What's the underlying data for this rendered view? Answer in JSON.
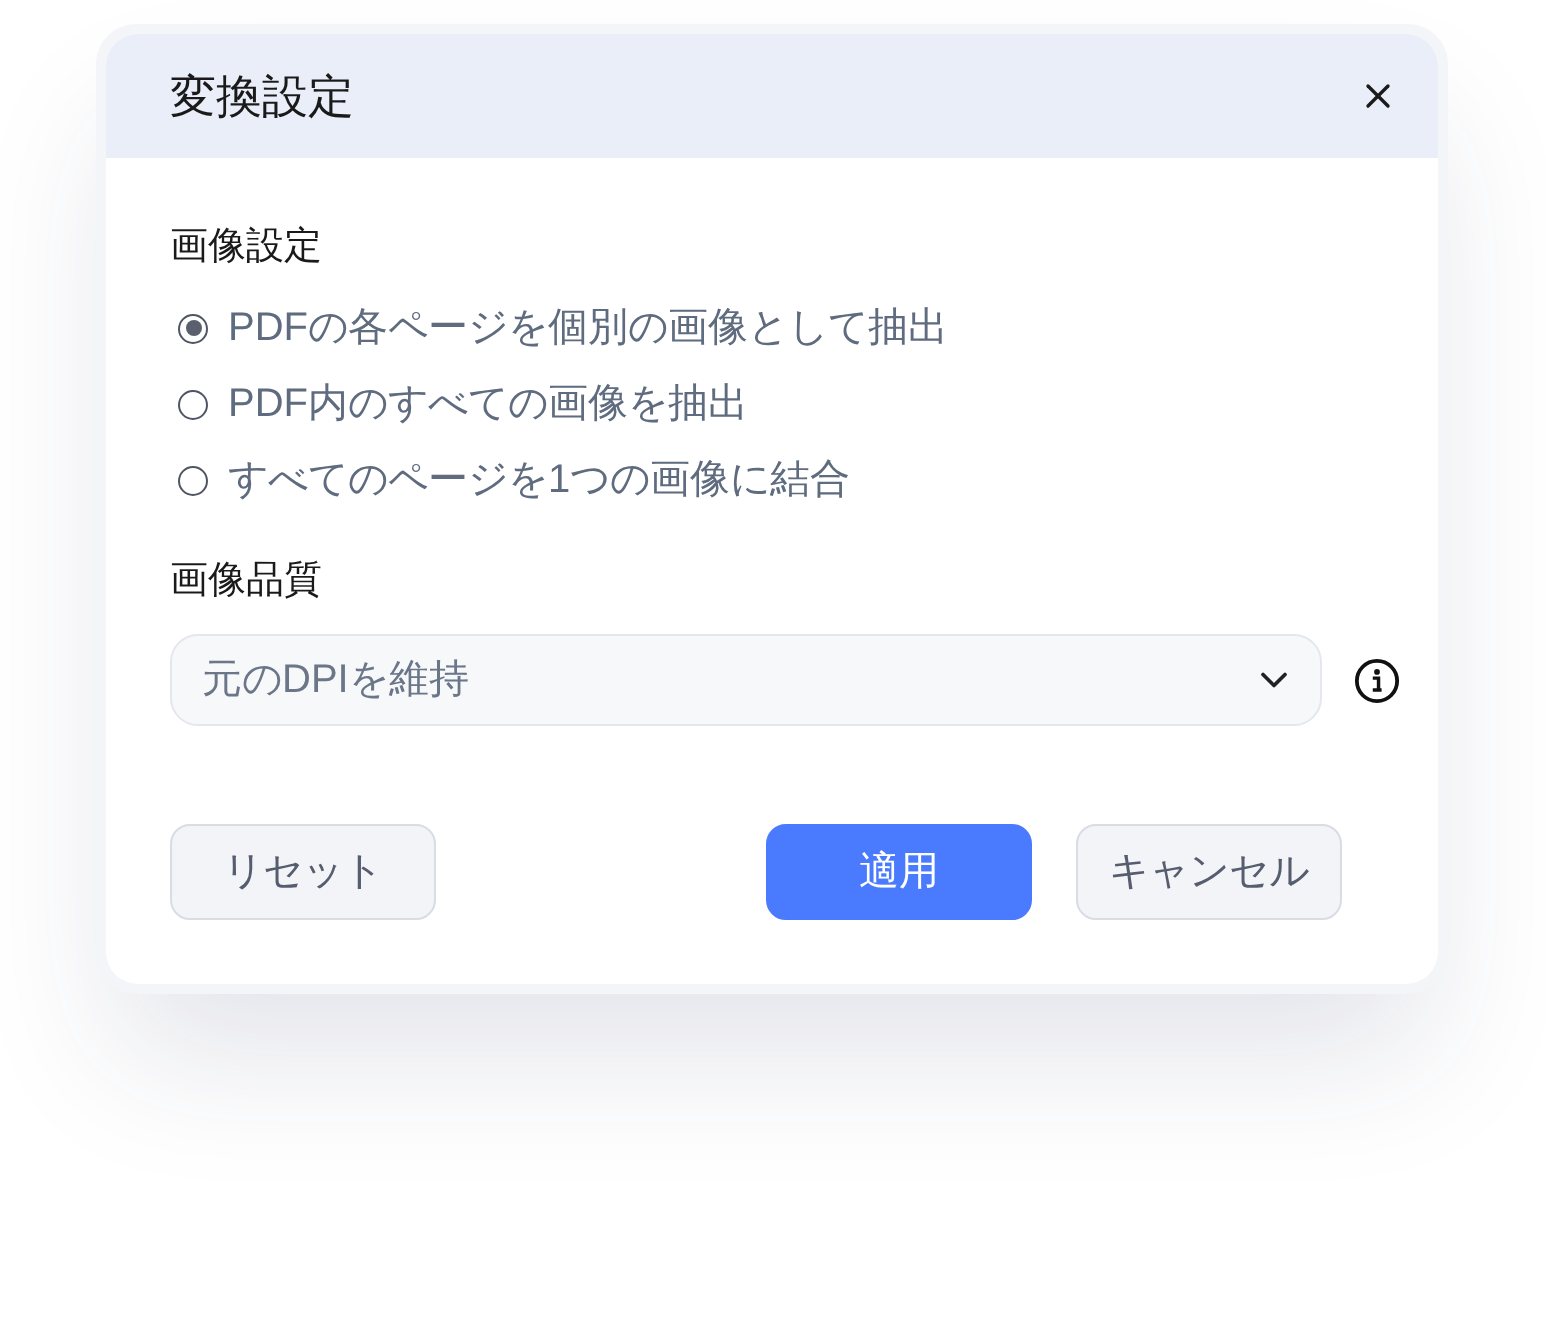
{
  "dialog": {
    "title": "変換設定"
  },
  "image_settings": {
    "label": "画像設定",
    "options": [
      {
        "label": "PDFの各ページを個別の画像として抽出",
        "selected": true
      },
      {
        "label": "PDF内のすべての画像を抽出",
        "selected": false
      },
      {
        "label": "すべてのページを1つの画像に結合",
        "selected": false
      }
    ]
  },
  "image_quality": {
    "label": "画像品質",
    "select": {
      "value": "元のDPIを維持"
    }
  },
  "buttons": [
    {
      "label": "リセット",
      "kind": "secondary"
    },
    {
      "label": "適用",
      "kind": "primary"
    },
    {
      "label": "キャンセル",
      "kind": "secondary"
    }
  ]
}
